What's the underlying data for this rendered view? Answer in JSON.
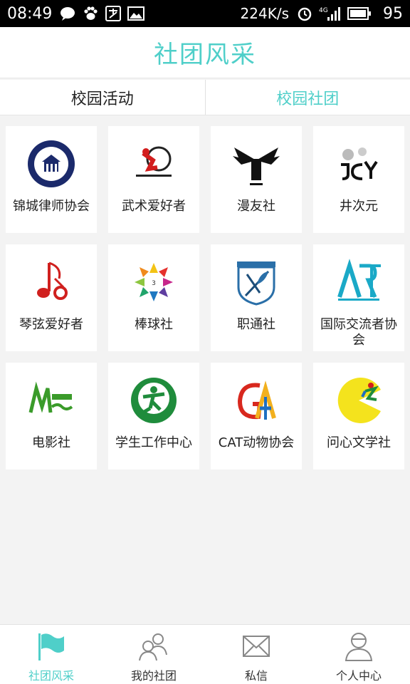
{
  "status_bar": {
    "time": "08:49",
    "speed": "224K/s",
    "signal": "4G",
    "battery": "95"
  },
  "header": {
    "title": "社团风采"
  },
  "tabs": [
    {
      "label": "校园活动",
      "active": false
    },
    {
      "label": "校园社团",
      "active": true
    }
  ],
  "clubs": [
    {
      "name": "锦城律师协会",
      "icon": "law-association-logo"
    },
    {
      "name": "武术爱好者",
      "icon": "martial-arts-logo"
    },
    {
      "name": "漫友社",
      "icon": "comic-club-logo"
    },
    {
      "name": "井次元",
      "icon": "jcy-logo"
    },
    {
      "name": "琴弦爱好者",
      "icon": "music-note-logo"
    },
    {
      "name": "棒球社",
      "icon": "clava-logo"
    },
    {
      "name": "职通社",
      "icon": "quill-shield-logo"
    },
    {
      "name": "国际交流者协会",
      "icon": "art-logo"
    },
    {
      "name": "电影社",
      "icon": "mango-logo"
    },
    {
      "name": "学生工作中心",
      "icon": "student-center-logo"
    },
    {
      "name": "CAT动物协会",
      "icon": "cat-ga-logo"
    },
    {
      "name": "问心文学社",
      "icon": "pacman-logo"
    }
  ],
  "bottom_nav": [
    {
      "label": "社团风采",
      "icon": "flag-icon",
      "active": true
    },
    {
      "label": "我的社团",
      "icon": "group-icon",
      "active": false
    },
    {
      "label": "私信",
      "icon": "mail-icon",
      "active": false
    },
    {
      "label": "个人中心",
      "icon": "person-icon",
      "active": false
    }
  ],
  "colors": {
    "accent": "#4fcfc9",
    "background": "#f3f3f3"
  }
}
